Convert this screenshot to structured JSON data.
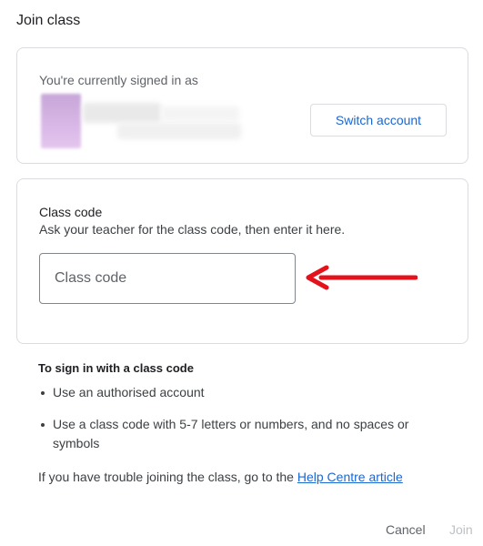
{
  "dialog": {
    "title": "Join class"
  },
  "account": {
    "signed_in_label": "You're currently signed in as",
    "switch_label": "Switch account"
  },
  "code_card": {
    "heading": "Class code",
    "subtext": "Ask your teacher for the class code, then enter it here.",
    "input_placeholder": "Class code",
    "input_value": ""
  },
  "info": {
    "heading": "To sign in with a class code",
    "items": [
      "Use an authorised account",
      "Use a class code with 5-7 letters or numbers, and no spaces or symbols"
    ],
    "trouble_prefix": "If you have trouble joining the class, go to the ",
    "help_link": "Help Centre article"
  },
  "footer": {
    "cancel_label": "Cancel",
    "join_label": "Join"
  },
  "colors": {
    "accent": "#1967d2",
    "annotation_arrow": "#e3121b",
    "border": "#dadce0"
  }
}
